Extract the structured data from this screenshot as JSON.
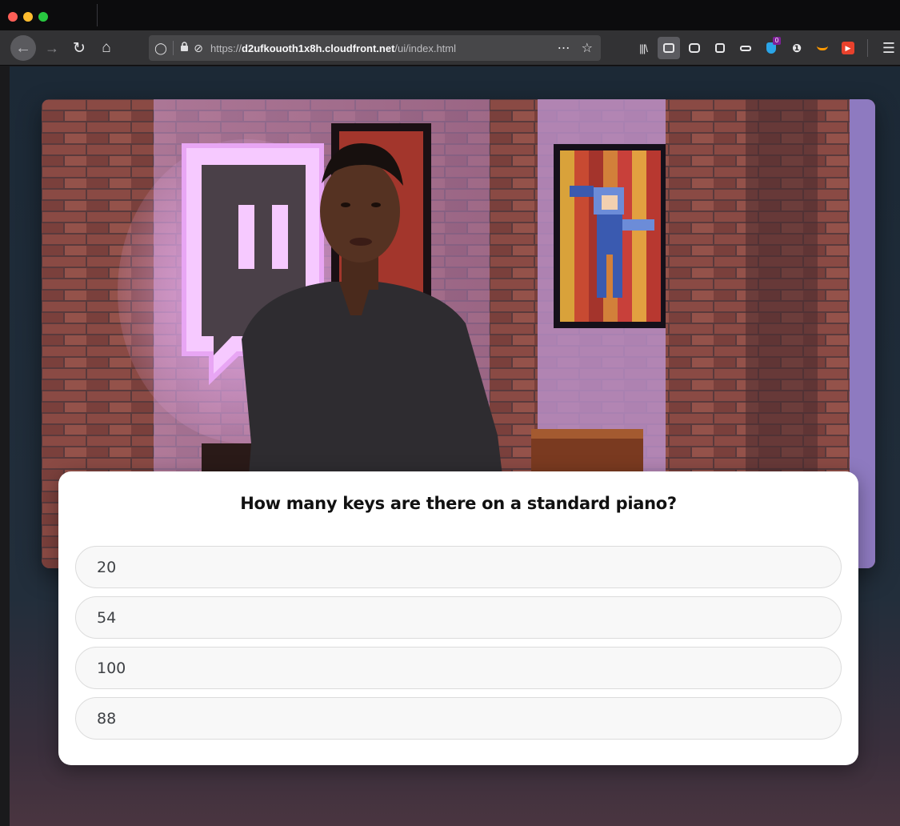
{
  "browser": {
    "url_prefix": "https://",
    "url_domain": "d2ufkouoth1x8h.cloudfront.net",
    "url_path": "/ui/index.html",
    "page_actions_icon": "more-icon",
    "bookmark_icon": "star-icon",
    "toolbar_icons": [
      "library-icon",
      "sidebar-icon",
      "mask-icon",
      "container-icon",
      "reader-icon",
      "dropbox-icon",
      "info-icon",
      "amazon-icon",
      "youtube-icon"
    ],
    "extension_badge": "0"
  },
  "quiz": {
    "question": "How many keys are there on a standard piano?",
    "answers": [
      {
        "label": "20"
      },
      {
        "label": "54"
      },
      {
        "label": "100"
      },
      {
        "label": "88"
      }
    ]
  },
  "colors": {
    "accent_twitch": "#9146ff",
    "card_bg": "#ffffff",
    "page_bg": "#1c2936"
  }
}
